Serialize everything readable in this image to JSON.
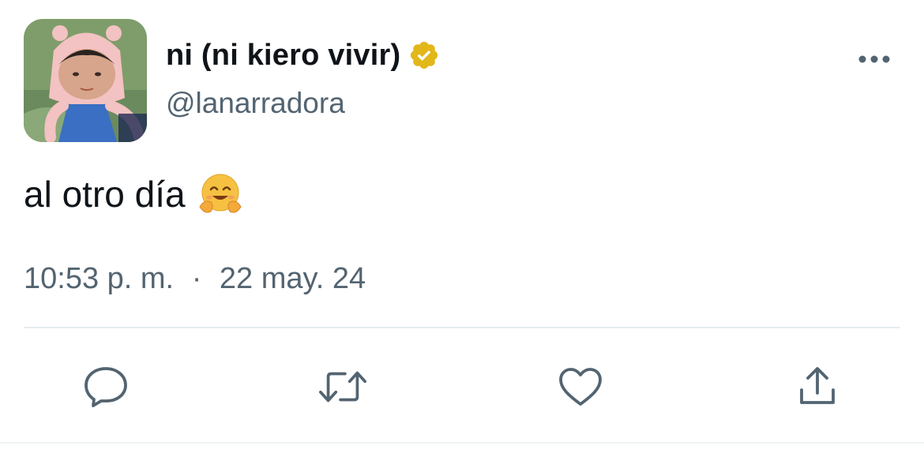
{
  "tweet": {
    "display_name": "ni (ni kiero vivir)",
    "handle": "@lanarradora",
    "text": "al otro día",
    "time": "10:53 p. m.",
    "separator": "·",
    "date": "22 may. 24"
  },
  "icons": {
    "avatar": "avatar-image",
    "verified": "gold-verified-badge-icon",
    "more": "more-dots-icon",
    "emoji": "hugging-face-emoji",
    "reply": "reply-icon",
    "retweet": "retweet-icon",
    "like": "heart-icon",
    "share": "share-icon"
  },
  "colors": {
    "text_primary": "#0f1419",
    "text_secondary": "#536471",
    "verified_gold": "#e2b719",
    "divider": "#e6ecf0"
  }
}
